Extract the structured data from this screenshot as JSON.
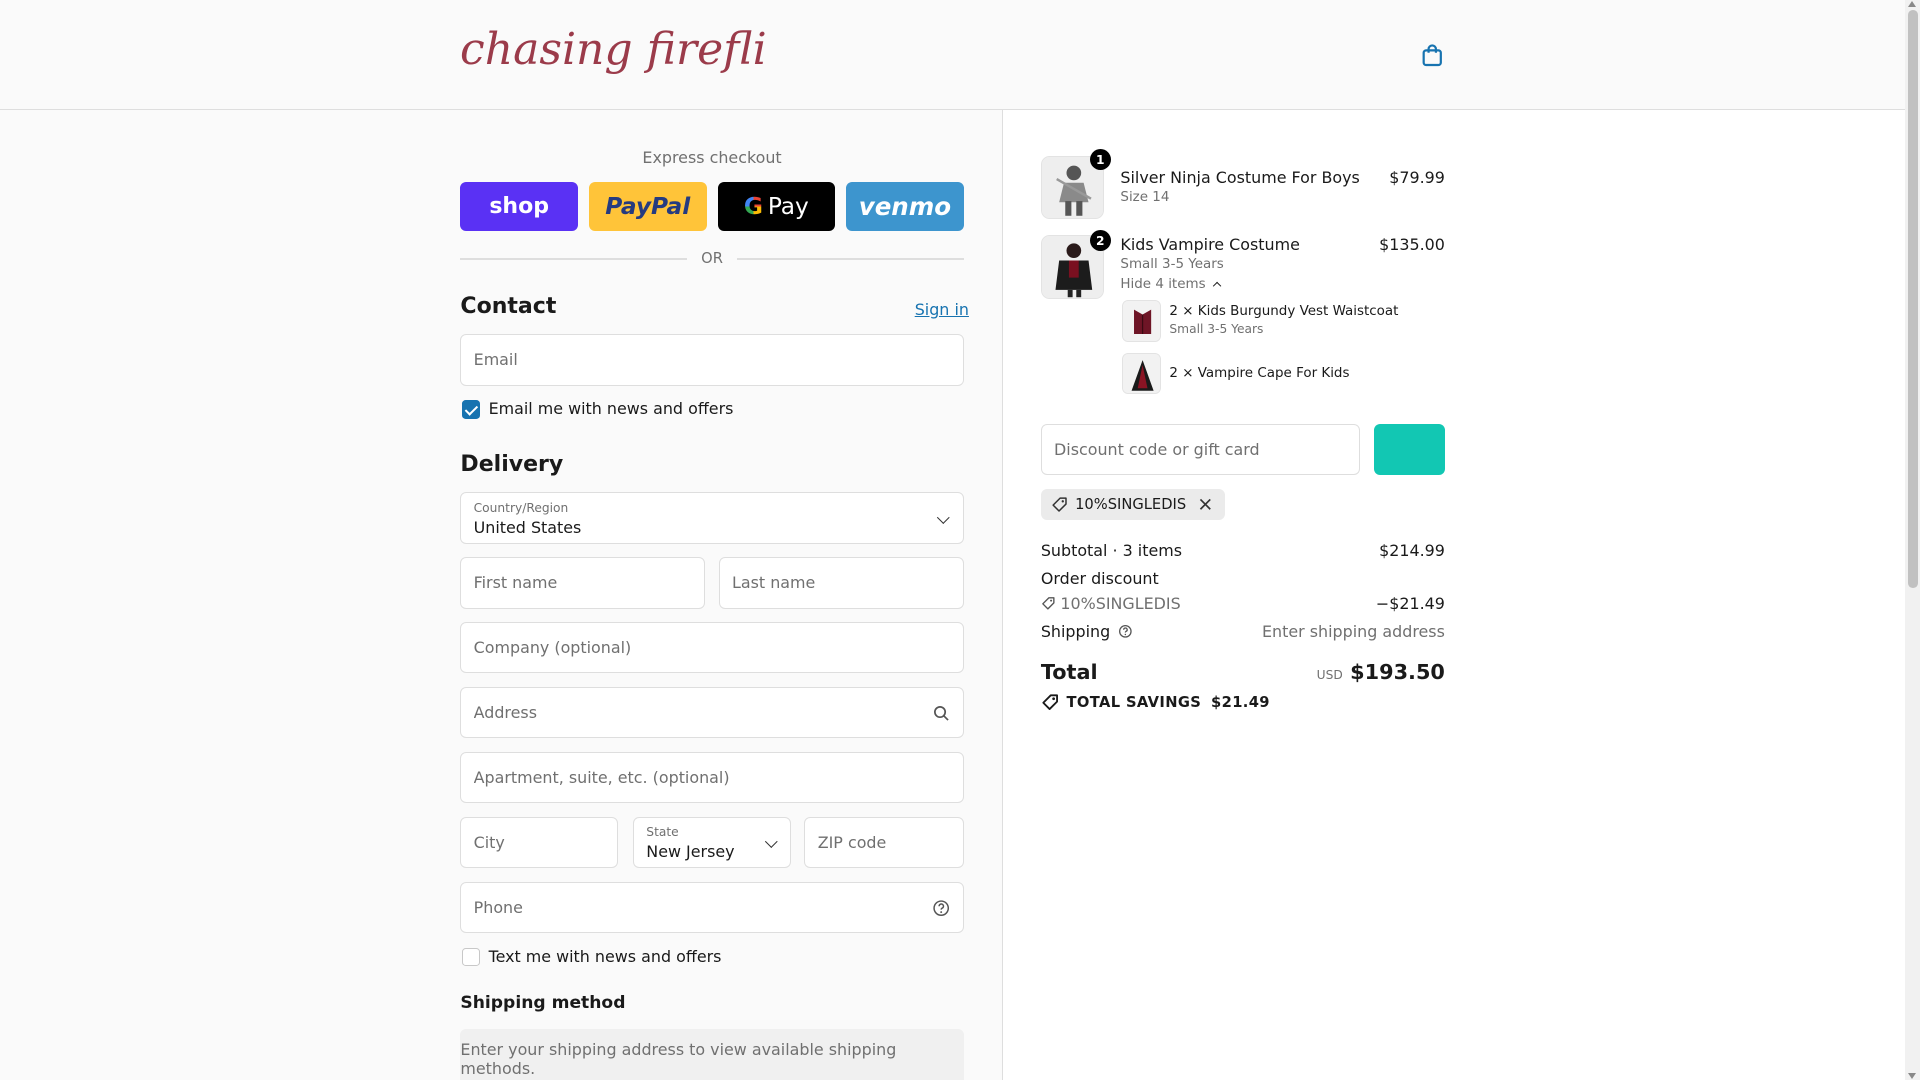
{
  "header": {
    "logo_text": "chasing fireflies",
    "cart_icon": "shopping-bag-icon"
  },
  "express": {
    "label": "Express checkout",
    "buttons": [
      "shop",
      "PayPal",
      "Pay",
      "venmo"
    ],
    "or": "OR"
  },
  "contact": {
    "title": "Contact",
    "sign_in": "Sign in",
    "email_placeholder": "Email",
    "news_label": "Email me with news and offers",
    "news_checked": true
  },
  "delivery": {
    "title": "Delivery",
    "country_label": "Country/Region",
    "country_value": "United States",
    "first_name": "First name",
    "last_name": "Last name",
    "company": "Company (optional)",
    "address": "Address",
    "apartment": "Apartment, suite, etc. (optional)",
    "city": "City",
    "state_label": "State",
    "state_value": "New Jersey",
    "zip": "ZIP code",
    "phone": "Phone",
    "text_label": "Text me with news and offers",
    "text_checked": false
  },
  "shipping_method": {
    "title": "Shipping method",
    "message": "Enter your shipping address to view available shipping methods."
  },
  "cart": {
    "items": [
      {
        "qty": "1",
        "name": "Silver Ninja Costume For Boys",
        "variant": "Size 14",
        "price": "$79.99"
      },
      {
        "qty": "2",
        "name": "Kids Vampire Costume",
        "variant": "Small 3-5 Years",
        "price": "$135.00",
        "toggle": "Hide 4 items"
      }
    ],
    "bundle_items": [
      {
        "name": "2 × Kids Burgundy Vest Waistcoat",
        "variant": "Small 3-5 Years"
      },
      {
        "name": "2 × Vampire Cape For Kids",
        "variant": ""
      }
    ]
  },
  "discount": {
    "placeholder": "Discount code or gift card",
    "applied_code": "10%SINGLEDIS"
  },
  "summary": {
    "subtotal_label": "Subtotal · 3 items",
    "subtotal_value": "$214.99",
    "order_discount_label": "Order discount",
    "discount_code": "10%SINGLEDIS",
    "discount_value": "−$21.49",
    "shipping_label": "Shipping",
    "shipping_value": "Enter shipping address",
    "total_label": "Total",
    "currency": "USD",
    "total_value": "$193.50",
    "savings_label": "TOTAL SAVINGS",
    "savings_value": "$21.49"
  },
  "colors": {
    "accent": "#1773b0",
    "apply_button": "#12c7b3",
    "logo": "#9b3b4a"
  }
}
